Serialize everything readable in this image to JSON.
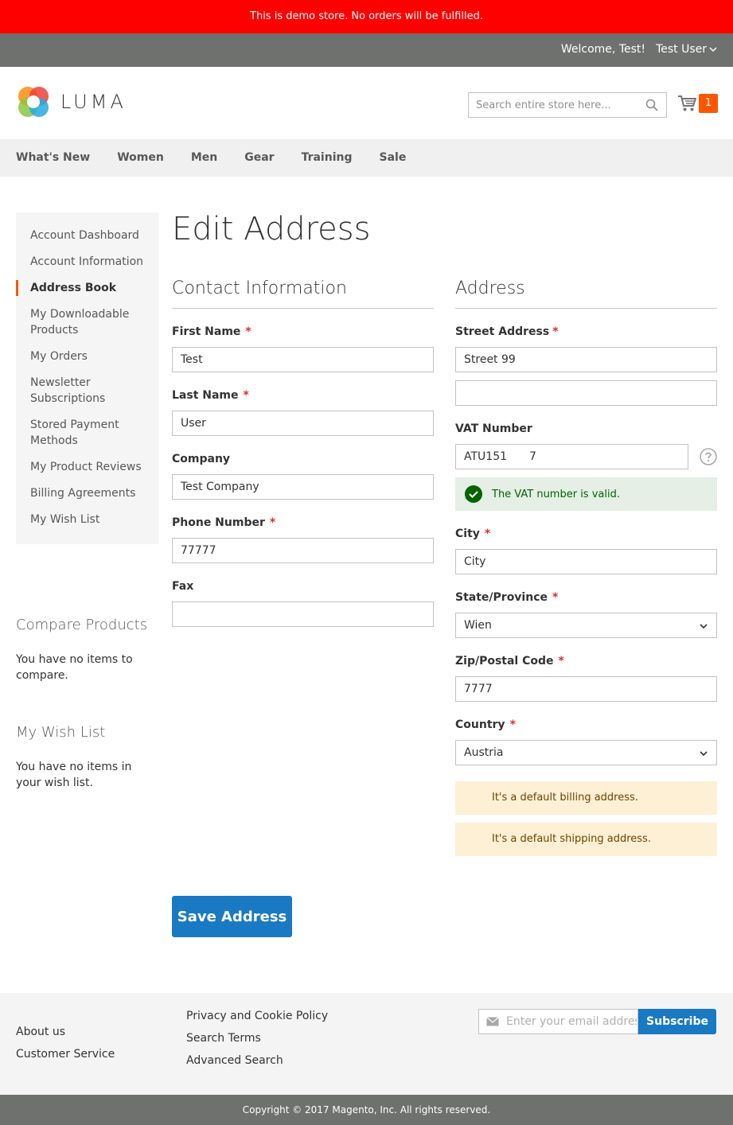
{
  "demo_notice": "This is demo store. No orders will be fulfilled.",
  "panel": {
    "welcome": "Welcome, Test!",
    "user_name": "Test User"
  },
  "header": {
    "logo_text": "LUMA",
    "search_placeholder": "Search entire store here...",
    "cart_count": "1"
  },
  "nav": {
    "items": [
      "What's New",
      "Women",
      "Men",
      "Gear",
      "Training",
      "Sale"
    ]
  },
  "sidebar": {
    "items": [
      "Account Dashboard",
      "Account Information",
      "Address Book",
      "My Downloadable Products",
      "My Orders",
      "Newsletter Subscriptions",
      "Stored Payment Methods",
      "My Product Reviews",
      "Billing Agreements",
      "My Wish List"
    ],
    "current_index": 2
  },
  "compare": {
    "title": "Compare Products",
    "text": "You have no items to compare."
  },
  "wishlist": {
    "title": "My Wish List",
    "text": "You have no items in your wish list."
  },
  "page_title": "Edit Address",
  "contact": {
    "title": "Contact Information",
    "first_name": {
      "label": "First Name",
      "value": "Test"
    },
    "last_name": {
      "label": "Last Name",
      "value": "User"
    },
    "company": {
      "label": "Company",
      "value": "Test Company"
    },
    "phone": {
      "label": "Phone Number",
      "value": "77777"
    },
    "fax": {
      "label": "Fax",
      "value": ""
    }
  },
  "address": {
    "title": "Address",
    "street": {
      "label": "Street Address",
      "line1": "Street 99",
      "line2": ""
    },
    "vat": {
      "label": "VAT Number",
      "value": "ATU151    7",
      "valid_message": "The VAT number is valid."
    },
    "city": {
      "label": "City",
      "value": "City"
    },
    "state": {
      "label": "State/Province",
      "value": "Wien"
    },
    "zip": {
      "label": "Zip/Postal Code",
      "value": "7777"
    },
    "country": {
      "label": "Country",
      "value": "Austria"
    },
    "default_billing": "It's a default billing address.",
    "default_shipping": "It's a default shipping address."
  },
  "save_label": "Save Address",
  "required_mark": "*",
  "footer": {
    "links_col1": [
      "About us",
      "Customer Service"
    ],
    "links_col2": [
      "Privacy and Cookie Policy",
      "Search Terms",
      "Advanced Search"
    ],
    "newsletter_placeholder": "Enter your email address",
    "subscribe_label": "Subscribe",
    "copyright": "Copyright © 2017 Magento, Inc. All rights reserved."
  },
  "colors": {
    "accent": "#ff5501",
    "primary": "#1979c3",
    "demo_bar": "#ff0000",
    "panel": "#6e716e"
  }
}
